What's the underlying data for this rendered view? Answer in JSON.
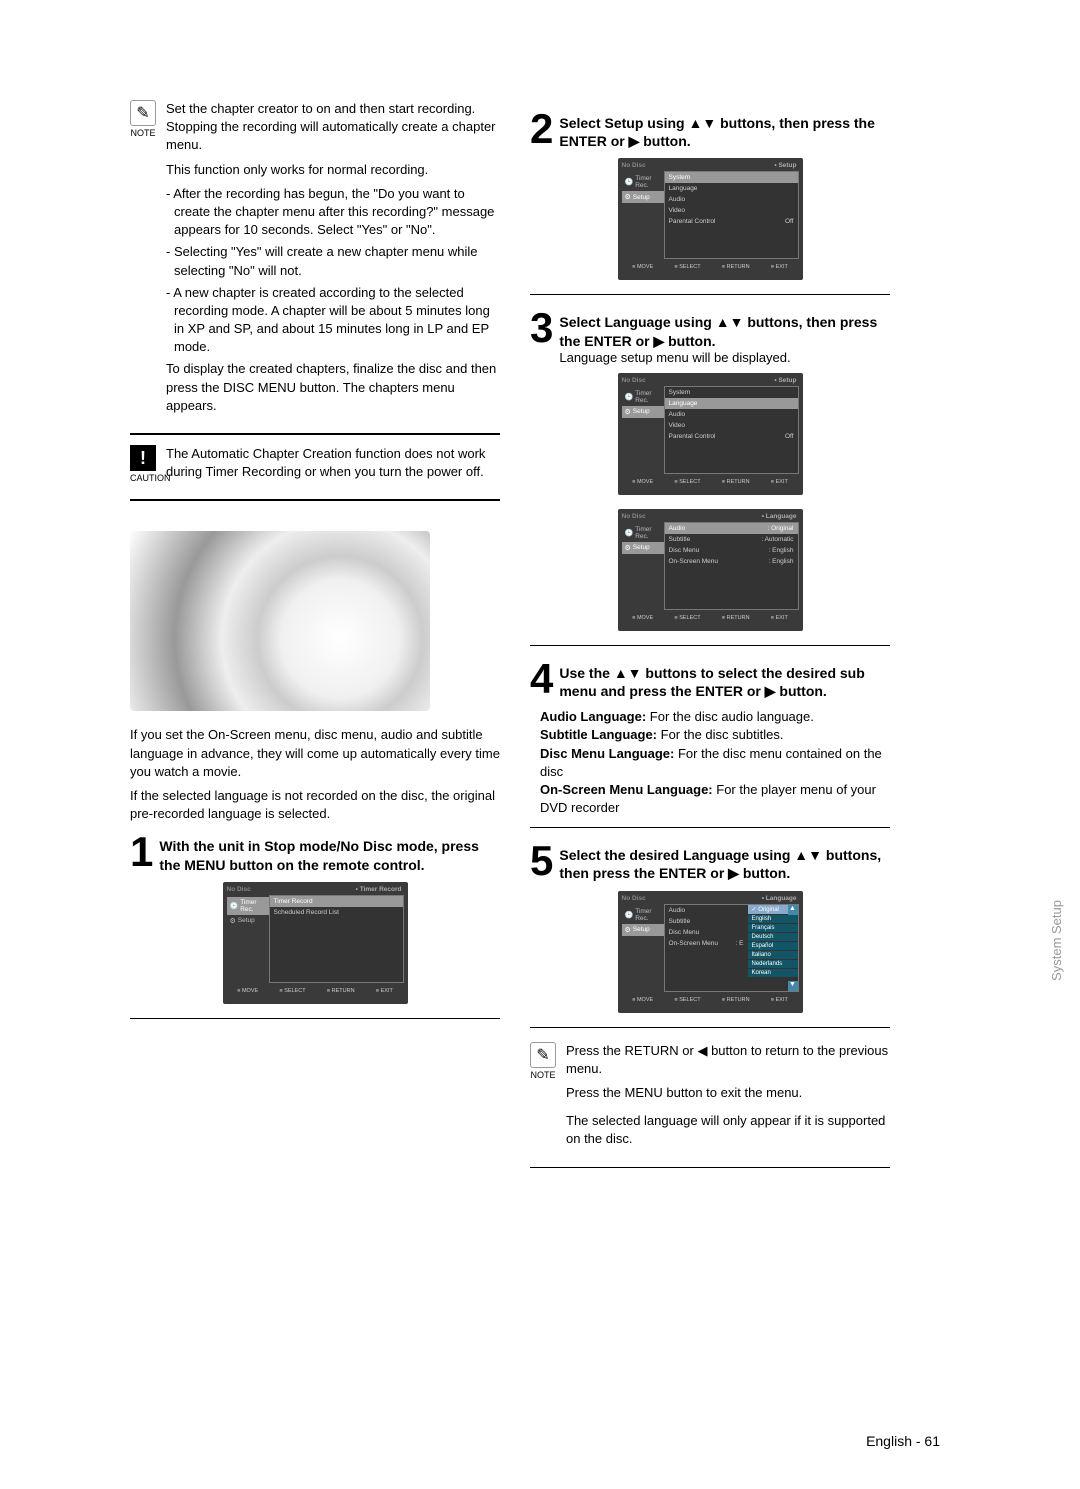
{
  "note1": {
    "label": "NOTE",
    "intro": "Set the chapter creator to on and then start recording. Stopping the recording will automatically create a chapter menu.",
    "line1": "This function only works for normal recording.",
    "bullets": [
      "- After the recording has begun, the \"Do you want to create the chapter menu after this recording?\" message appears for 10 seconds. Select \"Yes\" or \"No\".",
      "- Selecting \"Yes\" will create a new chapter menu while selecting \"No\" will not.",
      "- A new chapter is created according to the selected recording mode. A chapter will be about 5 minutes long in XP and SP, and about 15 minutes long in LP and EP mode."
    ],
    "tail": "To display the created chapters, finalize the disc and then press the DISC MENU button. The chapters menu appears."
  },
  "caution": {
    "label": "CAUTION",
    "text": "The Automatic Chapter Creation function does not work during Timer Recording or when you turn the power off."
  },
  "section": {
    "intro1": "If you set the On-Screen menu, disc menu, audio and subtitle language in advance, they will come up automatically every time you watch a movie.",
    "intro2": "If the selected language is not recorded on the disc, the original pre-recorded language is selected."
  },
  "steps": {
    "s1": "With the unit in Stop mode/No Disc mode, press the MENU button on the remote control.",
    "s2": "Select Setup using ▲▼ buttons, then press the ENTER or ▶ button.",
    "s3": "Select Language using ▲▼ buttons, then press the ENTER or ▶ button.",
    "s3_sub": "Language setup menu will be displayed.",
    "s4": "Use the ▲▼ buttons to select the desired sub menu and press the ENTER or ▶ button.",
    "s5": "Select the desired Language using ▲▼ buttons, then press the ENTER or ▶ button."
  },
  "submenu": {
    "audio_l": "Audio Language:",
    "audio_t": "For the disc audio language.",
    "sub_l": "Subtitle Language:",
    "sub_t": "For the disc subtitles.",
    "disc_l": "Disc Menu Language:",
    "disc_t": "For the disc menu contained on the disc",
    "osm_l": "On-Screen Menu Language:",
    "osm_t": "For the player menu of your DVD recorder"
  },
  "note2": {
    "label": "NOTE",
    "l1": "Press the RETURN or ◀ button to return to the previous menu.",
    "l2": "Press the MENU button to exit the menu.",
    "l3": "The selected language will only appear if it is supported on the disc."
  },
  "osd": {
    "nodisc": "No Disc",
    "timer_rec": "Timer Rec.",
    "setup": "Setup",
    "crumb_timer": "Timer Record",
    "crumb_setup": "Setup",
    "crumb_lang": "Language",
    "m_timer": "Timer Record",
    "m_sched": "Scheduled Record List",
    "m_system": "System",
    "m_lang": "Language",
    "m_audio": "Audio",
    "m_video": "Video",
    "m_parental": "Parental Control",
    "m_pc_val": "Off",
    "lang_audio": "Audio",
    "lang_audio_v": ": Original",
    "lang_subtitle": "Subtitle",
    "lang_subtitle_v": ": Automatic",
    "lang_discmenu": "Disc Menu",
    "lang_discmenu_v": ": English",
    "lang_osm": "On-Screen Menu",
    "lang_osm_v": ": English",
    "langs": [
      "Original",
      "English",
      "Français",
      "Deutsch",
      "Español",
      "Italiano",
      "Nederlands",
      "Korean"
    ],
    "foot_move": "MOVE",
    "foot_select": "SELECT",
    "foot_return": "RETURN",
    "foot_exit": "EXIT"
  },
  "footer": {
    "page": "English - 61"
  },
  "side_tab": "System Setup"
}
